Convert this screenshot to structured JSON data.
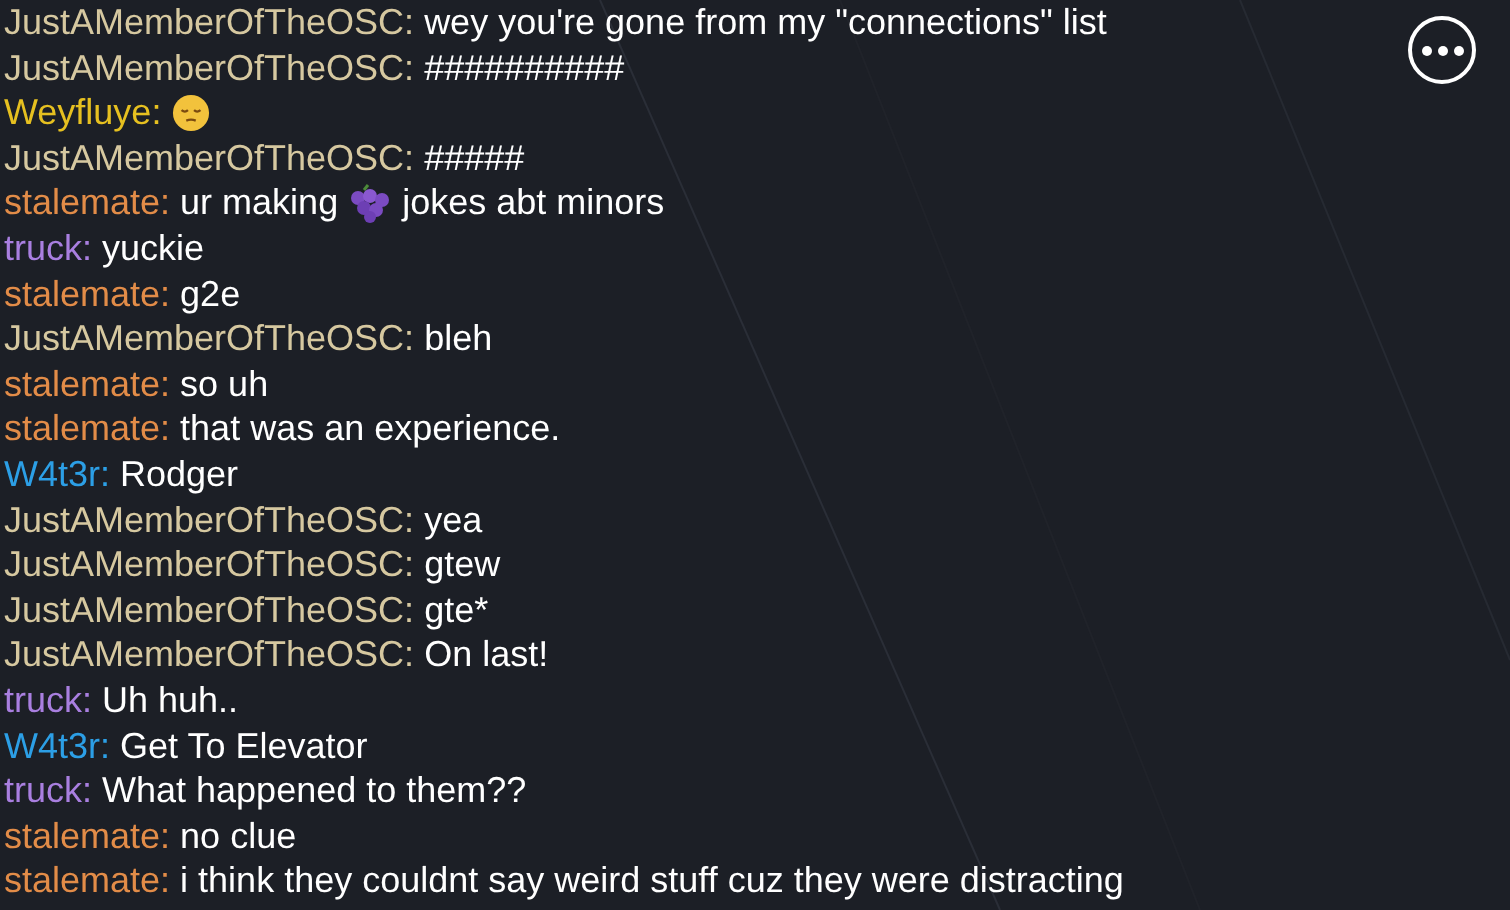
{
  "messages": [
    {
      "name": "JustAMemberOfTheOSC:",
      "color": "#d6c8a0",
      "parts": [
        {
          "kind": "text",
          "text": "wey you're gone from my \"connections\" list"
        }
      ]
    },
    {
      "name": "JustAMemberOfTheOSC:",
      "color": "#d6c8a0",
      "parts": [
        {
          "kind": "text",
          "text": "##########"
        }
      ]
    },
    {
      "name": "Weyfluye:",
      "color": "#e6c020",
      "parts": [
        {
          "kind": "face"
        }
      ]
    },
    {
      "name": "JustAMemberOfTheOSC:",
      "color": "#d6c8a0",
      "parts": [
        {
          "kind": "text",
          "text": "#####"
        }
      ]
    },
    {
      "name": "stalemate:",
      "color": "#e28c48",
      "parts": [
        {
          "kind": "text",
          "text": "ur making"
        },
        {
          "kind": "grapes"
        },
        {
          "kind": "text",
          "text": "jokes abt minors"
        }
      ]
    },
    {
      "name": "truck:",
      "color": "#a97fe0",
      "parts": [
        {
          "kind": "text",
          "text": "yuckie"
        }
      ]
    },
    {
      "name": "stalemate:",
      "color": "#e28c48",
      "parts": [
        {
          "kind": "text",
          "text": "g2e"
        }
      ]
    },
    {
      "name": "JustAMemberOfTheOSC:",
      "color": "#d6c8a0",
      "parts": [
        {
          "kind": "text",
          "text": "bleh"
        }
      ]
    },
    {
      "name": "stalemate:",
      "color": "#e28c48",
      "parts": [
        {
          "kind": "text",
          "text": "so uh"
        }
      ]
    },
    {
      "name": "stalemate:",
      "color": "#e28c48",
      "parts": [
        {
          "kind": "text",
          "text": "that was an experience."
        }
      ]
    },
    {
      "name": "W4t3r:",
      "color": "#2c9fe6",
      "parts": [
        {
          "kind": "text",
          "text": "Rodger"
        }
      ]
    },
    {
      "name": "JustAMemberOfTheOSC:",
      "color": "#d6c8a0",
      "parts": [
        {
          "kind": "text",
          "text": "yea"
        }
      ]
    },
    {
      "name": "JustAMemberOfTheOSC:",
      "color": "#d6c8a0",
      "parts": [
        {
          "kind": "text",
          "text": "gtew"
        }
      ]
    },
    {
      "name": "JustAMemberOfTheOSC:",
      "color": "#d6c8a0",
      "parts": [
        {
          "kind": "text",
          "text": "gte*"
        }
      ]
    },
    {
      "name": "JustAMemberOfTheOSC:",
      "color": "#d6c8a0",
      "parts": [
        {
          "kind": "text",
          "text": "On last!"
        }
      ]
    },
    {
      "name": "truck:",
      "color": "#a97fe0",
      "parts": [
        {
          "kind": "text",
          "text": "Uh huh.."
        }
      ]
    },
    {
      "name": "W4t3r:",
      "color": "#2c9fe6",
      "parts": [
        {
          "kind": "text",
          "text": "Get To Elevator"
        }
      ]
    },
    {
      "name": "truck:",
      "color": "#a97fe0",
      "parts": [
        {
          "kind": "text",
          "text": "What happened to them??"
        }
      ]
    },
    {
      "name": "stalemate:",
      "color": "#e28c48",
      "parts": [
        {
          "kind": "text",
          "text": "no clue"
        }
      ]
    },
    {
      "name": "stalemate:",
      "color": "#e28c48",
      "parts": [
        {
          "kind": "text",
          "text": "i think they couldnt say weird stuff cuz they were distracting"
        }
      ]
    }
  ]
}
